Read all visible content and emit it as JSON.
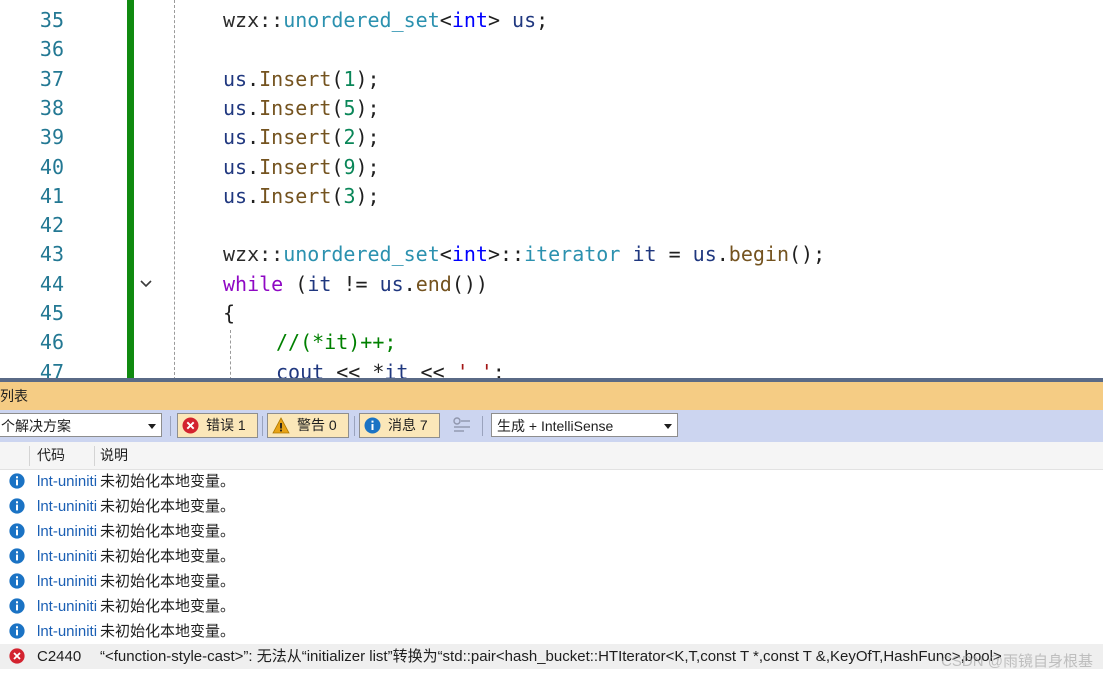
{
  "editor": {
    "line_numbers": [
      "35",
      "36",
      "37",
      "38",
      "39",
      "40",
      "41",
      "42",
      "43",
      "44",
      "45",
      "46",
      "47"
    ],
    "lines": [
      {
        "tokens": [
          [
            "t-ns",
            "wzx::"
          ],
          [
            "t-type",
            "unordered_set"
          ],
          [
            "t-op",
            "<"
          ],
          [
            "t-kw",
            "int"
          ],
          [
            "t-op",
            "> "
          ],
          [
            "t-var",
            "us"
          ],
          [
            "t-op",
            ";"
          ]
        ]
      },
      {
        "tokens": []
      },
      {
        "tokens": [
          [
            "t-var",
            "us"
          ],
          [
            "t-op",
            "."
          ],
          [
            "t-fn",
            "Insert"
          ],
          [
            "t-op",
            "("
          ],
          [
            "t-num",
            "1"
          ],
          [
            "t-op",
            ");"
          ]
        ]
      },
      {
        "tokens": [
          [
            "t-var",
            "us"
          ],
          [
            "t-op",
            "."
          ],
          [
            "t-fn",
            "Insert"
          ],
          [
            "t-op",
            "("
          ],
          [
            "t-num",
            "5"
          ],
          [
            "t-op",
            ");"
          ]
        ]
      },
      {
        "tokens": [
          [
            "t-var",
            "us"
          ],
          [
            "t-op",
            "."
          ],
          [
            "t-fn",
            "Insert"
          ],
          [
            "t-op",
            "("
          ],
          [
            "t-num",
            "2"
          ],
          [
            "t-op",
            ");"
          ]
        ]
      },
      {
        "tokens": [
          [
            "t-var",
            "us"
          ],
          [
            "t-op",
            "."
          ],
          [
            "t-fn",
            "Insert"
          ],
          [
            "t-op",
            "("
          ],
          [
            "t-num",
            "9"
          ],
          [
            "t-op",
            ");"
          ]
        ]
      },
      {
        "tokens": [
          [
            "t-var",
            "us"
          ],
          [
            "t-op",
            "."
          ],
          [
            "t-fn",
            "Insert"
          ],
          [
            "t-op",
            "("
          ],
          [
            "t-num",
            "3"
          ],
          [
            "t-op",
            ");"
          ]
        ]
      },
      {
        "tokens": []
      },
      {
        "tokens": [
          [
            "t-ns",
            "wzx::"
          ],
          [
            "t-type",
            "unordered_set"
          ],
          [
            "t-op",
            "<"
          ],
          [
            "t-kw",
            "int"
          ],
          [
            "t-op",
            ">::"
          ],
          [
            "t-type",
            "iterator"
          ],
          [
            "t-op",
            " "
          ],
          [
            "t-var",
            "it"
          ],
          [
            "t-op",
            " = "
          ],
          [
            "t-var",
            "us"
          ],
          [
            "t-op",
            "."
          ],
          [
            "t-fn",
            "begin"
          ],
          [
            "t-op",
            "();"
          ]
        ]
      },
      {
        "tokens": [
          [
            "t-ctl",
            "while"
          ],
          [
            "t-op",
            " ("
          ],
          [
            "t-var",
            "it"
          ],
          [
            "t-op",
            " != "
          ],
          [
            "t-var",
            "us"
          ],
          [
            "t-op",
            "."
          ],
          [
            "t-fn",
            "end"
          ],
          [
            "t-op",
            "())"
          ]
        ]
      },
      {
        "tokens": [
          [
            "t-op",
            "{"
          ]
        ]
      },
      {
        "indent": true,
        "tokens": [
          [
            "t-cmt",
            "//(*it)++;"
          ]
        ]
      },
      {
        "indent": true,
        "tokens": [
          [
            "t-var",
            "cout"
          ],
          [
            "t-op",
            " << *"
          ],
          [
            "t-var",
            "it"
          ],
          [
            "t-op",
            " << "
          ],
          [
            "t-str",
            "' '"
          ],
          [
            "t-op",
            ";"
          ]
        ]
      }
    ]
  },
  "panel": {
    "title": "列表",
    "scope_label": "个解决方案",
    "errors_label": "错误 1",
    "warnings_label": "警告 0",
    "messages_label": "消息 7",
    "filter_label": "生成 + IntelliSense",
    "col_code": "代码",
    "col_desc": "说明"
  },
  "rows": [
    {
      "kind": "info",
      "code": "lnt-uninitialized-local",
      "desc": "未初始化本地变量。"
    },
    {
      "kind": "info",
      "code": "lnt-uninitialized-local",
      "desc": "未初始化本地变量。"
    },
    {
      "kind": "info",
      "code": "lnt-uninitialized-local",
      "desc": "未初始化本地变量。"
    },
    {
      "kind": "info",
      "code": "lnt-uninitialized-local",
      "desc": "未初始化本地变量。"
    },
    {
      "kind": "info",
      "code": "lnt-uninitialized-local",
      "desc": "未初始化本地变量。"
    },
    {
      "kind": "info",
      "code": "lnt-uninitialized-local",
      "desc": "未初始化本地变量。"
    },
    {
      "kind": "info",
      "code": "lnt-uninitialized-local",
      "desc": "未初始化本地变量。"
    },
    {
      "kind": "error",
      "code": "C2440",
      "desc": "“<function-style-cast>”: 无法从“initializer list”转换为“std::pair<hash_bucket::HTIterator<K,T,const T *,const T &,KeyOfT,HashFunc>,bool>"
    }
  ],
  "watermark": "CSDN @雨镜自身根基",
  "colors": {
    "error": "#d3232f",
    "info": "#1b73c4",
    "warning": "#e8a317",
    "change_bar": "#108a10",
    "title_bar": "#f5cc84"
  }
}
